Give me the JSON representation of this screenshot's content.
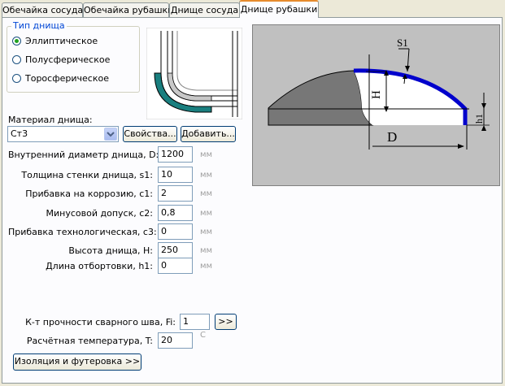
{
  "tabs": [
    {
      "label": "Обечайка сосуда"
    },
    {
      "label": "Обечайка рубашки"
    },
    {
      "label": "Днище сосуда"
    },
    {
      "label": "Днище рубашки"
    }
  ],
  "head_type": {
    "title": "Тип днища",
    "options": [
      {
        "label": "Эллиптическое",
        "selected": true
      },
      {
        "label": "Полусферическое",
        "selected": false
      },
      {
        "label": "Торосферическое",
        "selected": false
      }
    ]
  },
  "material": {
    "label": "Материал днища:",
    "value": "Ст3",
    "properties_button": "Свойства...",
    "add_button": "Добавить..."
  },
  "fields": [
    {
      "label": "Внутренний диаметр днища, D:",
      "value": "1200",
      "unit": "мм"
    },
    {
      "label": "Толщина стенки днища, s1:",
      "value": "10",
      "unit": "мм"
    },
    {
      "label": "Прибавка на коррозию, c1:",
      "value": "2",
      "unit": "мм"
    },
    {
      "label": "Минусовой допуск, c2:",
      "value": "0,8",
      "unit": "мм"
    },
    {
      "label": "Прибавка технологическая, c3:",
      "value": "0",
      "unit": "мм"
    },
    {
      "label": "Высота днища, H:",
      "value": "250",
      "unit": "мм"
    },
    {
      "label": "Длина отбортовки, h1:",
      "value": "0",
      "unit": "мм"
    }
  ],
  "weld": {
    "label": "К-т прочности сварного шва, Fi:",
    "value": "1",
    "button": ">>"
  },
  "temperature": {
    "label": "Расчётная температура, T:",
    "value": "20",
    "unit": "С"
  },
  "insulation_button": "Изоляция и футеровка >>",
  "drawing_labels": {
    "s1": "S1",
    "H": "H",
    "h1": "h1",
    "D": "D"
  },
  "colors": {
    "accent_tab": "#e68b2c",
    "head_wall": "#0000cc",
    "jacket_fill": "#1a7f7f",
    "drawing_bg": "#c0c0c0"
  }
}
